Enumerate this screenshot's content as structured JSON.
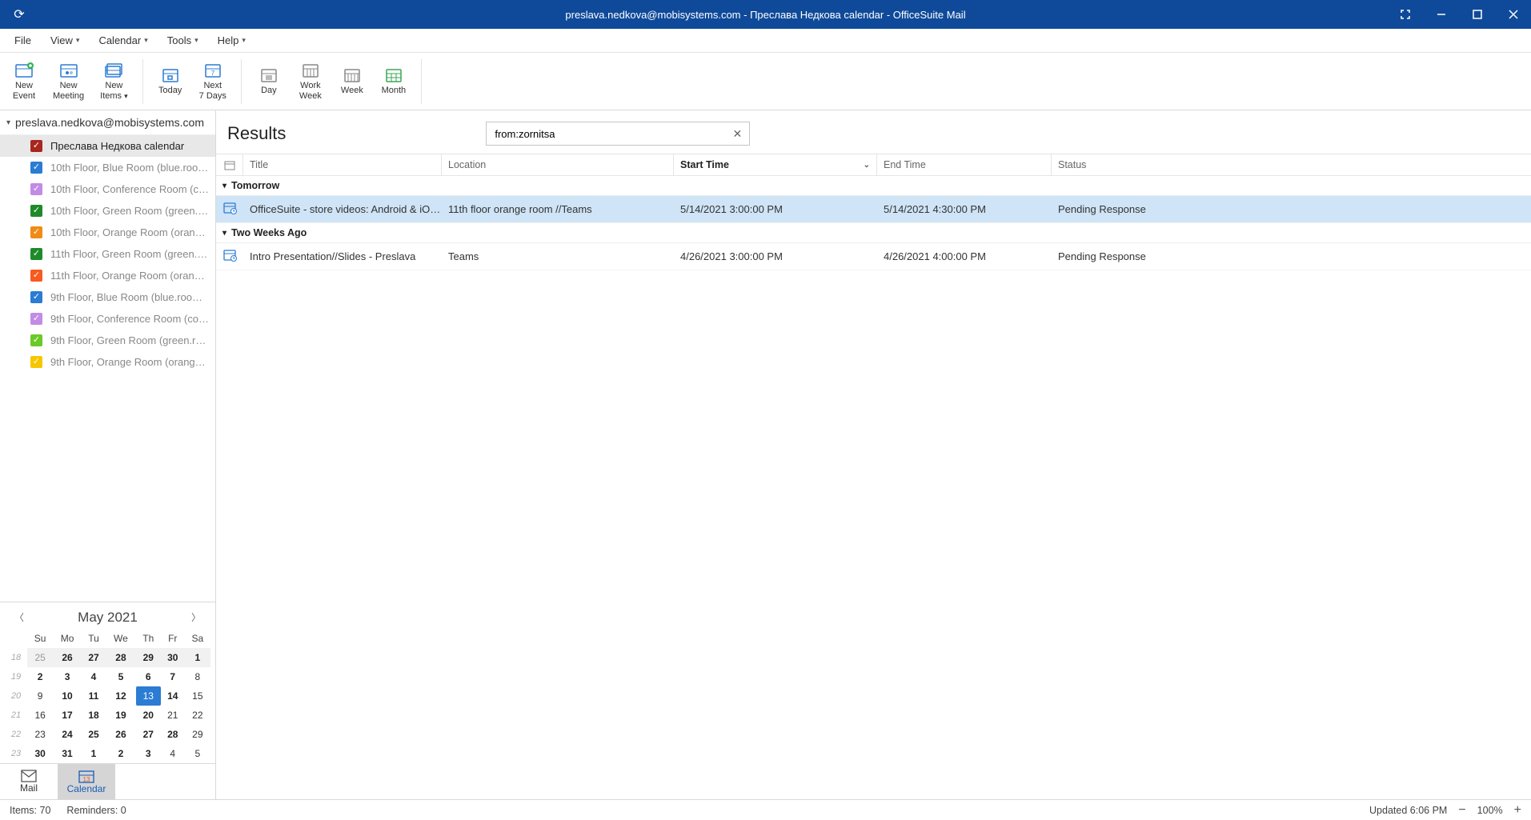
{
  "titlebar": {
    "title": "preslava.nedkova@mobisystems.com - Преслава Недкова calendar - OfficeSuite Mail"
  },
  "menu": {
    "file": "File",
    "view": "View",
    "calendar": "Calendar",
    "tools": "Tools",
    "help": "Help"
  },
  "ribbon": {
    "new_event": "New\nEvent",
    "new_meeting": "New\nMeeting",
    "new_items": "New\nItems",
    "today": "Today",
    "next7": "Next\n7 Days",
    "day": "Day",
    "work_week": "Work\nWeek",
    "week": "Week",
    "month": "Month"
  },
  "account": {
    "email": "preslava.nedkova@mobisystems.com"
  },
  "calendars": [
    {
      "label": "Преслава Недкова calendar",
      "color": "#a7261e",
      "selected": true
    },
    {
      "label": "10th Floor, Blue Room (blue.room.10…",
      "color": "#2b7cd3",
      "selected": false
    },
    {
      "label": "10th Floor, Conference Room (conf…",
      "color": "#c28be6",
      "selected": false
    },
    {
      "label": "10th Floor, Green Room (green.roo…",
      "color": "#1f8a2a",
      "selected": false
    },
    {
      "label": "10th Floor, Orange Room (orange.ro…",
      "color": "#f08c16",
      "selected": false
    },
    {
      "label": "11th Floor, Green Room (green.roo…",
      "color": "#1f8a2a",
      "selected": false
    },
    {
      "label": "11th Floor, Orange Room (orange.ro…",
      "color": "#f95a1f",
      "selected": false
    },
    {
      "label": "9th Floor, Blue Room (blue.room.9@…",
      "color": "#2b7cd3",
      "selected": false
    },
    {
      "label": "9th Floor, Conference Room (confer…",
      "color": "#c28be6",
      "selected": false
    },
    {
      "label": "9th Floor, Green Room (green.room…",
      "color": "#6cc928",
      "selected": false
    },
    {
      "label": "9th Floor, Orange Room (orange roo…",
      "color": "#f7c600",
      "selected": false
    }
  ],
  "datepicker": {
    "title": "May 2021",
    "dow": [
      "Su",
      "Mo",
      "Tu",
      "We",
      "Th",
      "Fr",
      "Sa"
    ],
    "rows": [
      {
        "wk": "18",
        "days": [
          {
            "n": "25",
            "dim": true
          },
          {
            "n": "26",
            "bold": true
          },
          {
            "n": "27",
            "bold": true
          },
          {
            "n": "28",
            "bold": true
          },
          {
            "n": "29",
            "bold": true
          },
          {
            "n": "30",
            "bold": true
          },
          {
            "n": "1",
            "bold": true
          }
        ]
      },
      {
        "wk": "19",
        "days": [
          {
            "n": "2",
            "bold": true
          },
          {
            "n": "3",
            "bold": true
          },
          {
            "n": "4",
            "bold": true
          },
          {
            "n": "5",
            "bold": true
          },
          {
            "n": "6",
            "bold": true
          },
          {
            "n": "7",
            "bold": true
          },
          {
            "n": "8"
          }
        ]
      },
      {
        "wk": "20",
        "days": [
          {
            "n": "9"
          },
          {
            "n": "10",
            "bold": true
          },
          {
            "n": "11",
            "bold": true
          },
          {
            "n": "12",
            "bold": true
          },
          {
            "n": "13",
            "today": true
          },
          {
            "n": "14",
            "bold": true
          },
          {
            "n": "15"
          }
        ]
      },
      {
        "wk": "21",
        "days": [
          {
            "n": "16"
          },
          {
            "n": "17",
            "bold": true
          },
          {
            "n": "18",
            "bold": true
          },
          {
            "n": "19",
            "bold": true
          },
          {
            "n": "20",
            "bold": true
          },
          {
            "n": "21"
          },
          {
            "n": "22"
          }
        ]
      },
      {
        "wk": "22",
        "days": [
          {
            "n": "23"
          },
          {
            "n": "24",
            "bold": true
          },
          {
            "n": "25",
            "bold": true
          },
          {
            "n": "26",
            "bold": true
          },
          {
            "n": "27",
            "bold": true
          },
          {
            "n": "28",
            "bold": true
          },
          {
            "n": "29"
          }
        ]
      },
      {
        "wk": "23",
        "days": [
          {
            "n": "30",
            "bold": true
          },
          {
            "n": "31",
            "bold": true
          },
          {
            "n": "1",
            "bold": true
          },
          {
            "n": "2",
            "bold": true
          },
          {
            "n": "3",
            "bold": true
          },
          {
            "n": "4"
          },
          {
            "n": "5"
          }
        ]
      }
    ]
  },
  "navfooter": {
    "mail": "Mail",
    "calendar": "Calendar"
  },
  "results": {
    "title": "Results",
    "search_value": "from:zornitsa",
    "columns": {
      "title": "Title",
      "location": "Location",
      "start": "Start Time",
      "end": "End Time",
      "status": "Status"
    },
    "groups": [
      {
        "name": "Tomorrow",
        "rows": [
          {
            "title": "OfficeSuite - store videos: Android & iOS/br…",
            "location": "11th floor orange room //Teams",
            "start": "5/14/2021 3:00:00 PM",
            "end": "5/14/2021 4:30:00 PM",
            "status": "Pending Response",
            "selected": true
          }
        ]
      },
      {
        "name": "Two Weeks Ago",
        "rows": [
          {
            "title": "Intro Presentation//Slides - Preslava",
            "location": "Teams",
            "start": "4/26/2021 3:00:00 PM",
            "end": "4/26/2021 4:00:00 PM",
            "status": "Pending Response",
            "selected": false
          }
        ]
      }
    ]
  },
  "statusbar": {
    "items": "Items: 70",
    "reminders": "Reminders: 0",
    "updated": "Updated 6:06 PM",
    "zoom": "100%"
  }
}
